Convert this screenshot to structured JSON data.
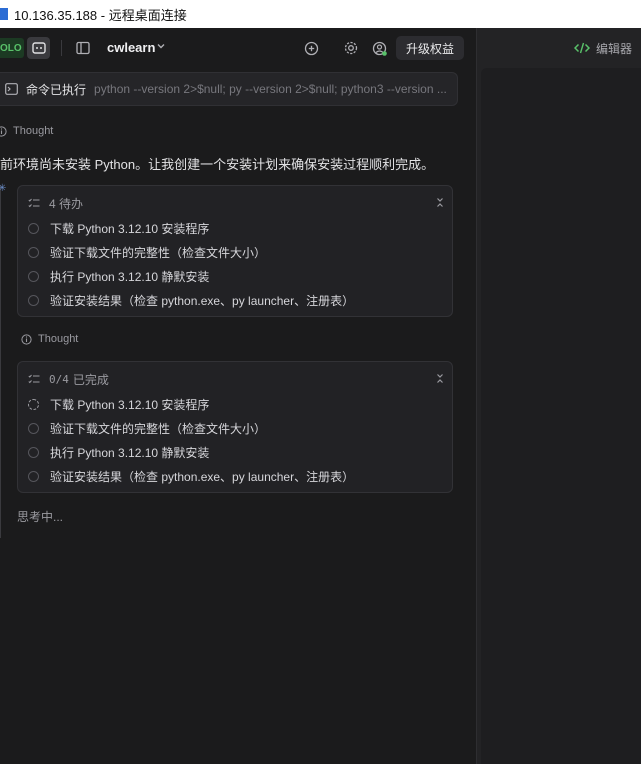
{
  "window": {
    "title": "10.136.35.188 - 远程桌面连接"
  },
  "header": {
    "solo_badge": "OLO",
    "project_name": "cwlearn",
    "upgrade_label": "升级权益"
  },
  "right_panel": {
    "editor_label": "编辑器"
  },
  "command": {
    "label": "命令已执行",
    "code": "python --version 2>$null; py --version 2>$null; python3 --version ..."
  },
  "thought_label": "Thought",
  "message": "当前环境尚未安装 Python。让我创建一个安装计划来确保安装过程顺利完成。",
  "todo_lists": [
    {
      "header": "4 待办",
      "items": [
        {
          "text": "下载 Python 3.12.10 安装程序",
          "status": "pending"
        },
        {
          "text": "验证下载文件的完整性（检查文件大小）",
          "status": "pending"
        },
        {
          "text": "执行 Python 3.12.10 静默安装",
          "status": "pending"
        },
        {
          "text": "验证安装结果（检查 python.exe、py launcher、注册表）",
          "status": "pending"
        }
      ]
    },
    {
      "header_count": "0/4",
      "header_suffix": "已完成",
      "items": [
        {
          "text": "下载 Python 3.12.10 安装程序",
          "status": "in_progress"
        },
        {
          "text": "验证下载文件的完整性（检查文件大小）",
          "status": "pending"
        },
        {
          "text": "执行 Python 3.12.10 静默安装",
          "status": "pending"
        },
        {
          "text": "验证安装结果（检查 python.exe、py launcher、注册表）",
          "status": "pending"
        }
      ]
    }
  ],
  "thinking_status": "思考中...",
  "colors": {
    "accent_green": "#59c26a",
    "background": "#1b1b1c",
    "card": "#222225"
  }
}
